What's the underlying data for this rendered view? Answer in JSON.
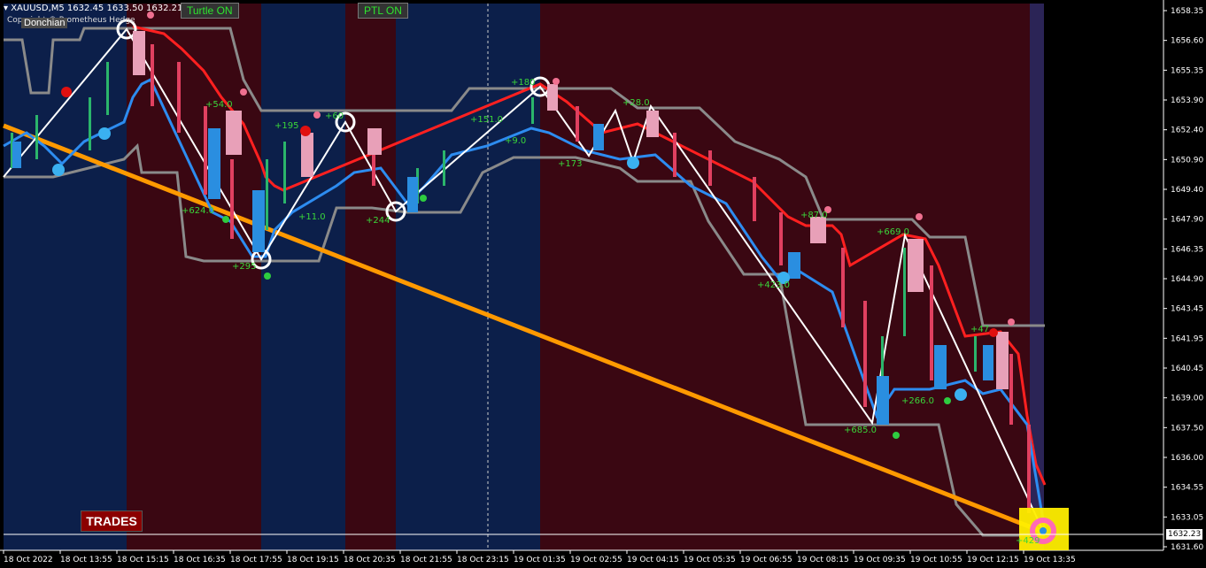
{
  "header": {
    "symbol_line": "▾ XAUUSD,M5  1632.45 1633.50 1632.21 163",
    "copyright": "Copyright © Prometheus Hedge"
  },
  "buttons": {
    "turtle": "Turtle ON",
    "ptl": "PTL ON",
    "donchian": "Donchian",
    "trades": "TRADES"
  },
  "price_axis": {
    "labels": [
      "1658.35",
      "1656.60",
      "1655.35",
      "1653.90",
      "1652.40",
      "1650.90",
      "1649.40",
      "1647.90",
      "1646.35",
      "1644.90",
      "1643.45",
      "1641.95",
      "1640.45",
      "1639.00",
      "1637.50",
      "1636.00",
      "1634.55",
      "1633.05",
      "1631.60"
    ],
    "current_price": "1632.23"
  },
  "time_axis": {
    "labels": [
      "18 Oct 2022",
      "18 Oct 13:55",
      "18 Oct 15:15",
      "18 Oct 16:35",
      "18 Oct 17:55",
      "18 Oct 19:15",
      "18 Oct 20:35",
      "18 Oct 21:55",
      "18 Oct 23:15",
      "19 Oct 01:35",
      "19 Oct 02:55",
      "19 Oct 04:15",
      "19 Oct 05:35",
      "19 Oct 06:55",
      "19 Oct 08:15",
      "19 Oct 09:35",
      "19 Oct 10:55",
      "19 Oct 12:15",
      "19 Oct 13:35"
    ]
  },
  "annotations": [
    "+54.0",
    "+624.0",
    "+295",
    "+195",
    "+60",
    "+11.0",
    "+244",
    "+151.0",
    "+180",
    "+9.0",
    "+173",
    "+28.0",
    "+87.0",
    "+423.0",
    "+669.0",
    "+685.0",
    "+266.0",
    "+47",
    "+429"
  ],
  "colors": {
    "blue_zone": "#0c1f4a",
    "red_zone": "#3a0712",
    "channel": "#8a8a8a",
    "trendline": "#ff9900",
    "zigzag": "#ffffff"
  }
}
